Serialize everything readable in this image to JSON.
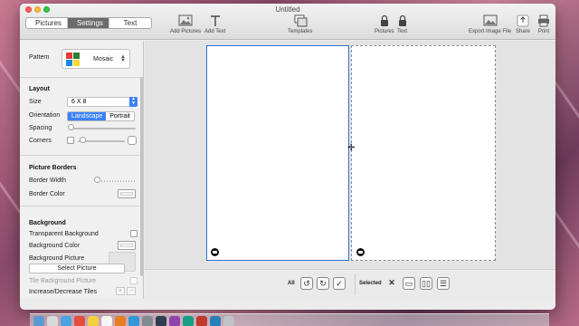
{
  "window": {
    "title": "Untitled"
  },
  "tabs": [
    {
      "label": "Pictures",
      "active": false
    },
    {
      "label": "Settings",
      "active": true
    },
    {
      "label": "Text",
      "active": false
    }
  ],
  "toolbar": {
    "add_pictures": "Add Pictures",
    "add_text": "Add Text",
    "templates": "Templates",
    "lock_pictures": "Pictures",
    "lock_text": "Text",
    "export": "Export Image File",
    "share": "Share",
    "print": "Print"
  },
  "sidebar": {
    "pattern_label": "Pattern",
    "pattern_value": "Mosaic",
    "layout_heading": "Layout",
    "size_label": "Size",
    "size_value": "6 X 8",
    "orientation_label": "Orientation",
    "orientation_options": [
      "Landscape",
      "Portrait"
    ],
    "orientation_selected": "Landscape",
    "spacing_label": "Spacing",
    "spacing_level": 0.02,
    "corners_label": "Corners",
    "corners_level": 0.05,
    "borders_heading": "Picture Borders",
    "border_width_label": "Border Width",
    "border_width_level": 0.0,
    "border_color_label": "Border Color",
    "background_heading": "Background",
    "transparent_bg_label": "Transparent Background",
    "transparent_bg_checked": false,
    "bg_color_label": "Background Color",
    "bg_picture_label": "Background Picture",
    "select_picture_label": "Select Picture",
    "tile_bg_label": "Tile Background Picture",
    "increase_tiles_label": "Increase/Decrease Tiles",
    "plus": "+",
    "minus": "−"
  },
  "bottombar": {
    "all_label": "All",
    "selected_label": "Selected"
  },
  "colors": {
    "accent": "#3b82f6",
    "selection_border": "#2f6fd1",
    "tab_active": "#6b6b6b"
  }
}
